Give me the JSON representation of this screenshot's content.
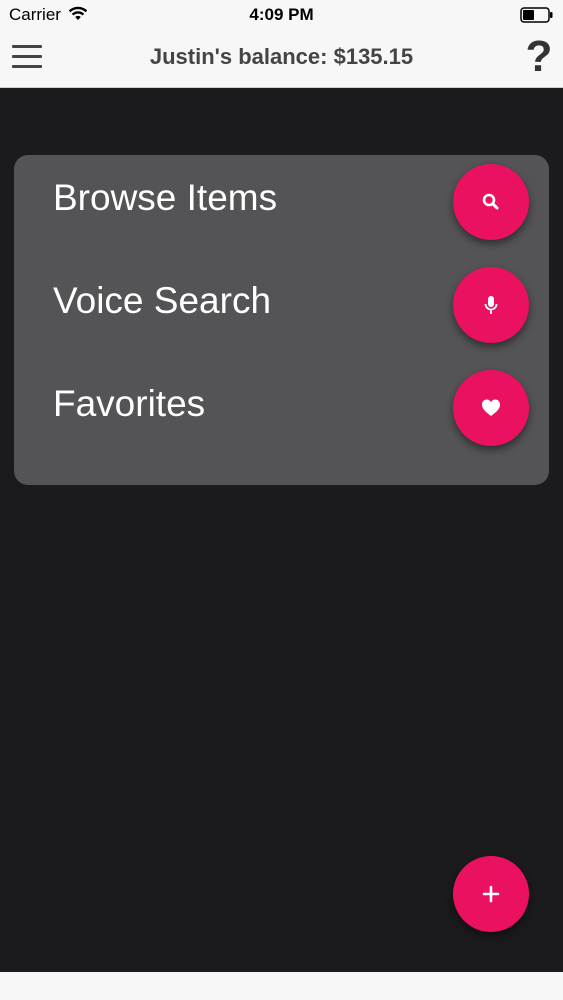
{
  "status_bar": {
    "carrier": "Carrier",
    "time": "4:09 PM",
    "wifi_icon": "wifi-icon",
    "battery_icon": "battery-icon"
  },
  "nav": {
    "menu_icon": "hamburger-menu-icon",
    "title": "Justin's balance: $135.15",
    "help_label": "?"
  },
  "menu": {
    "items": [
      {
        "label": "Browse Items",
        "icon": "search-icon"
      },
      {
        "label": "Voice Search",
        "icon": "microphone-icon"
      },
      {
        "label": "Favorites",
        "icon": "heart-icon"
      }
    ]
  },
  "fab": {
    "icon": "plus-icon"
  },
  "colors": {
    "accent": "#e91160",
    "background": "#1b1a1c",
    "panel": "#545355",
    "bar": "#f7f7f7"
  }
}
